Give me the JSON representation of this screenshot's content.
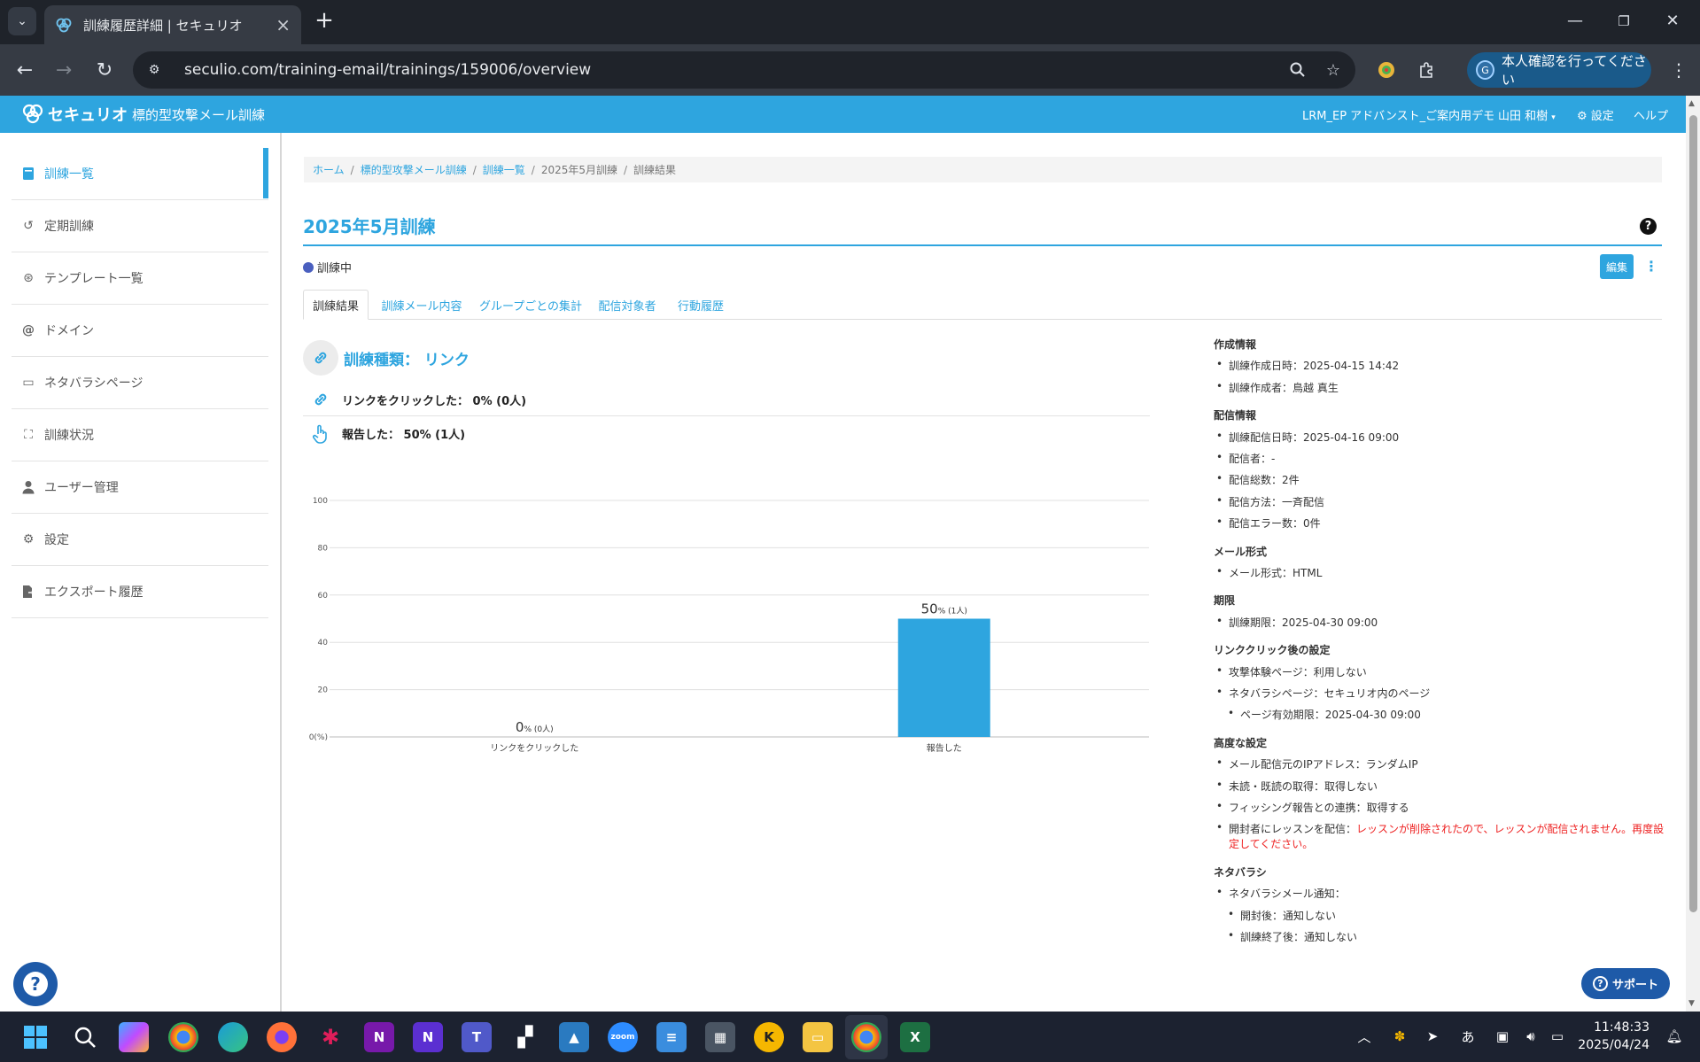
{
  "browser": {
    "tab_title": "訓練履歴詳細 | セキュリオ",
    "url": "seculio.com/training-email/trainings/159006/overview",
    "profile_button": "本人確認を行ってください",
    "profile_initial": "G"
  },
  "app": {
    "logo_text": "セキュリオ",
    "title": "標的型攻撃メール訓練",
    "header_nav": {
      "org": "LRM_EP アドバンスト_ご案内用デモ",
      "user": "山田 和樹",
      "settings": "設定",
      "help": "ヘルプ"
    }
  },
  "sidebar": {
    "items": [
      {
        "label": "訓練一覧",
        "icon": "book-icon",
        "active": true
      },
      {
        "label": "定期訓練",
        "icon": "history-icon",
        "active": false
      },
      {
        "label": "テンプレート一覧",
        "icon": "template-icon",
        "active": false
      },
      {
        "label": "ドメイン",
        "icon": "at-icon",
        "active": false
      },
      {
        "label": "ネタバラシページ",
        "icon": "page-icon",
        "active": false
      },
      {
        "label": "訓練状況",
        "icon": "group-icon",
        "active": false
      },
      {
        "label": "ユーザー管理",
        "icon": "user-icon",
        "active": false
      },
      {
        "label": "設定",
        "icon": "gear-icon",
        "active": false
      },
      {
        "label": "エクスポート履歴",
        "icon": "export-icon",
        "active": false
      }
    ]
  },
  "breadcrumb": {
    "items": [
      "ホーム",
      "標的型攻撃メール訓練",
      "訓練一覧",
      "2025年5月訓練",
      "訓練結果"
    ],
    "separator": "/"
  },
  "page": {
    "title": "2025年5月訓練",
    "status": "訓練中",
    "status_color": "#4a5fbf",
    "edit_label": "編集",
    "tabs": [
      "訓練結果",
      "訓練メール内容",
      "グループごとの集計",
      "配信対象者",
      "行動履歴"
    ],
    "training_type_label": "訓練種類： リンク",
    "metrics": [
      {
        "label": "リンクをクリックした： 0% (0人)"
      },
      {
        "label": "報告した： 50% (1人)"
      }
    ]
  },
  "chart_data": {
    "type": "bar",
    "categories": [
      "リンクをクリックした",
      "報告した"
    ],
    "values": [
      0,
      50
    ],
    "data_labels": [
      {
        "big": "0",
        "small": "% (0人)"
      },
      {
        "big": "50",
        "small": "% (1人)"
      }
    ],
    "yticks": [
      "0(%)",
      "20",
      "40",
      "60",
      "80",
      "100"
    ],
    "ylim": [
      0,
      100
    ],
    "bar_color": "#2ea5df",
    "grid": true
  },
  "info": {
    "sections": [
      {
        "heading": "作成情報",
        "items": [
          {
            "text": "訓練作成日時：2025-04-15 14:42"
          },
          {
            "text": "訓練作成者：鳥越 真生"
          }
        ]
      },
      {
        "heading": "配信情報",
        "items": [
          {
            "text": "訓練配信日時：2025-04-16 09:00"
          },
          {
            "text": "配信者：-"
          },
          {
            "text": "配信総数：2件"
          },
          {
            "text": "配信方法：一斉配信"
          },
          {
            "text": "配信エラー数：0件"
          }
        ]
      },
      {
        "heading": "メール形式",
        "items": [
          {
            "text": "メール形式：HTML"
          }
        ]
      },
      {
        "heading": "期限",
        "items": [
          {
            "text": "訓練期限：2025-04-30 09:00"
          }
        ]
      },
      {
        "heading": "リンククリック後の設定",
        "items": [
          {
            "text": "攻撃体験ページ：利用しない"
          },
          {
            "text": "ネタバラシページ：セキュリオ内のページ"
          },
          {
            "text": "ページ有効期限：2025-04-30 09:00",
            "sub": true
          }
        ]
      },
      {
        "heading": "高度な設定",
        "items": [
          {
            "text": "メール配信元のIPアドレス：ランダムIP"
          },
          {
            "text": "未読・既読の取得：取得しない"
          },
          {
            "text": "フィッシング報告との連携：取得する"
          },
          {
            "text": "開封者にレッスンを配信：",
            "warning_line1": "レッスンが削除されたので、レッスンが配信されません。再度設",
            "warning_line2": "定してください。"
          }
        ]
      },
      {
        "heading": "ネタバラシ",
        "items": [
          {
            "text": "ネタバラシメール通知："
          },
          {
            "text": "開封後：通知しない",
            "sub": true
          },
          {
            "text": "訓練終了後：通知しない",
            "sub": true
          }
        ]
      }
    ]
  },
  "support_label": "サポート",
  "taskbar": {
    "time": "11:48:33",
    "date": "2025/04/24",
    "ime": "あ"
  }
}
